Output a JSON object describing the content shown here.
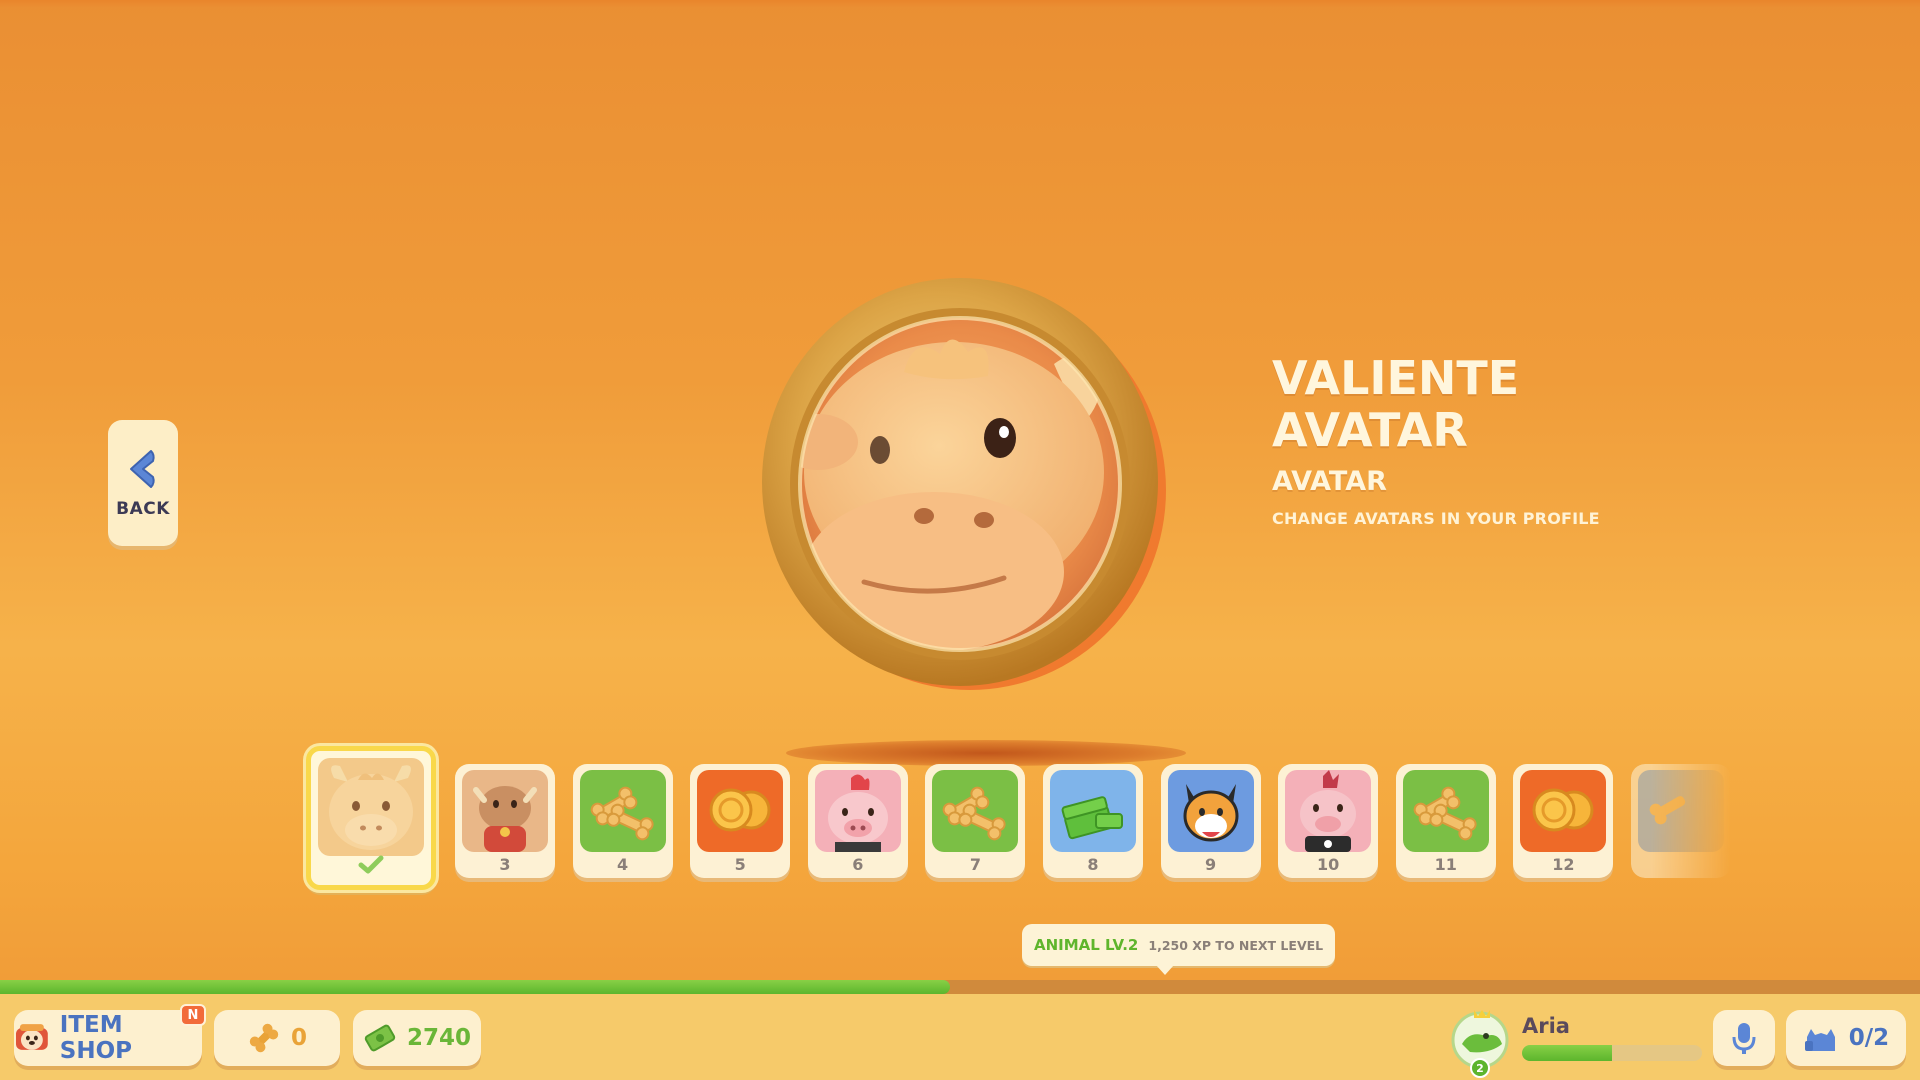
{
  "back": {
    "label": "BACK",
    "icon": "chevron-left-icon"
  },
  "reward": {
    "title_line1": "VALIENTE",
    "title_line2": "AVATAR",
    "type": "AVATAR",
    "description": "CHANGE AVATARS IN YOUR PROFILE",
    "art": "bull-avatar-coin"
  },
  "rewards": [
    {
      "number": "",
      "art": "bull-avatar",
      "selected": true,
      "claimed": true
    },
    {
      "number": "3",
      "art": "bull-outfit"
    },
    {
      "number": "4",
      "art": "bones"
    },
    {
      "number": "5",
      "art": "coins"
    },
    {
      "number": "6",
      "art": "pig-mohawk"
    },
    {
      "number": "7",
      "art": "bones"
    },
    {
      "number": "8",
      "art": "cash-stack"
    },
    {
      "number": "9",
      "art": "fox-sticker"
    },
    {
      "number": "10",
      "art": "pig-punk"
    },
    {
      "number": "11",
      "art": "bones"
    },
    {
      "number": "12",
      "art": "coins"
    },
    {
      "number": "",
      "art": "bones-partial"
    }
  ],
  "xp": {
    "level_label": "ANIMAL LV.2",
    "next_label": "1,250 XP TO NEXT LEVEL",
    "progress_fraction": 0.495
  },
  "bottom_bar": {
    "item_shop_label": "ITEM SHOP",
    "item_shop_badge": "N",
    "bones": "0",
    "cash": "2740",
    "player_name": "Aria",
    "player_level": "2",
    "player_progress_fraction": 0.5,
    "party": "0/2"
  },
  "colors": {
    "background": "#f09c3a",
    "accent_green": "#5cb52d",
    "panel": "#fdf0cf",
    "selected_border": "#f9d84a"
  }
}
